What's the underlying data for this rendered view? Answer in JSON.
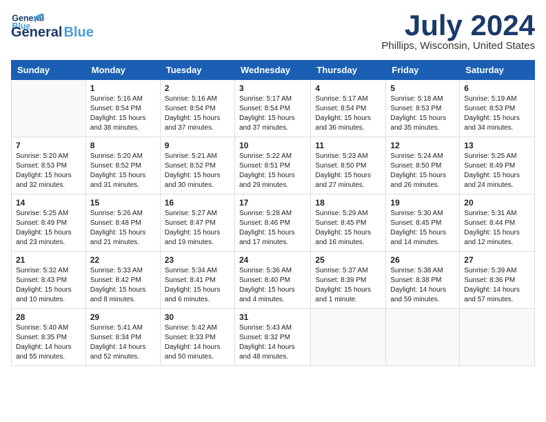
{
  "header": {
    "logo_line1": "General",
    "logo_line2": "Blue",
    "month": "July 2024",
    "location": "Phillips, Wisconsin, United States"
  },
  "weekdays": [
    "Sunday",
    "Monday",
    "Tuesday",
    "Wednesday",
    "Thursday",
    "Friday",
    "Saturday"
  ],
  "weeks": [
    [
      {
        "day": "",
        "info": ""
      },
      {
        "day": "1",
        "info": "Sunrise: 5:16 AM\nSunset: 8:54 PM\nDaylight: 15 hours\nand 38 minutes."
      },
      {
        "day": "2",
        "info": "Sunrise: 5:16 AM\nSunset: 8:54 PM\nDaylight: 15 hours\nand 37 minutes."
      },
      {
        "day": "3",
        "info": "Sunrise: 5:17 AM\nSunset: 8:54 PM\nDaylight: 15 hours\nand 37 minutes."
      },
      {
        "day": "4",
        "info": "Sunrise: 5:17 AM\nSunset: 8:54 PM\nDaylight: 15 hours\nand 36 minutes."
      },
      {
        "day": "5",
        "info": "Sunrise: 5:18 AM\nSunset: 8:53 PM\nDaylight: 15 hours\nand 35 minutes."
      },
      {
        "day": "6",
        "info": "Sunrise: 5:19 AM\nSunset: 8:53 PM\nDaylight: 15 hours\nand 34 minutes."
      }
    ],
    [
      {
        "day": "7",
        "info": "Sunrise: 5:20 AM\nSunset: 8:53 PM\nDaylight: 15 hours\nand 32 minutes."
      },
      {
        "day": "8",
        "info": "Sunrise: 5:20 AM\nSunset: 8:52 PM\nDaylight: 15 hours\nand 31 minutes."
      },
      {
        "day": "9",
        "info": "Sunrise: 5:21 AM\nSunset: 8:52 PM\nDaylight: 15 hours\nand 30 minutes."
      },
      {
        "day": "10",
        "info": "Sunrise: 5:22 AM\nSunset: 8:51 PM\nDaylight: 15 hours\nand 29 minutes."
      },
      {
        "day": "11",
        "info": "Sunrise: 5:23 AM\nSunset: 8:50 PM\nDaylight: 15 hours\nand 27 minutes."
      },
      {
        "day": "12",
        "info": "Sunrise: 5:24 AM\nSunset: 8:50 PM\nDaylight: 15 hours\nand 26 minutes."
      },
      {
        "day": "13",
        "info": "Sunrise: 5:25 AM\nSunset: 8:49 PM\nDaylight: 15 hours\nand 24 minutes."
      }
    ],
    [
      {
        "day": "14",
        "info": "Sunrise: 5:25 AM\nSunset: 8:49 PM\nDaylight: 15 hours\nand 23 minutes."
      },
      {
        "day": "15",
        "info": "Sunrise: 5:26 AM\nSunset: 8:48 PM\nDaylight: 15 hours\nand 21 minutes."
      },
      {
        "day": "16",
        "info": "Sunrise: 5:27 AM\nSunset: 8:47 PM\nDaylight: 15 hours\nand 19 minutes."
      },
      {
        "day": "17",
        "info": "Sunrise: 5:28 AM\nSunset: 8:46 PM\nDaylight: 15 hours\nand 17 minutes."
      },
      {
        "day": "18",
        "info": "Sunrise: 5:29 AM\nSunset: 8:45 PM\nDaylight: 15 hours\nand 16 minutes."
      },
      {
        "day": "19",
        "info": "Sunrise: 5:30 AM\nSunset: 8:45 PM\nDaylight: 15 hours\nand 14 minutes."
      },
      {
        "day": "20",
        "info": "Sunrise: 5:31 AM\nSunset: 8:44 PM\nDaylight: 15 hours\nand 12 minutes."
      }
    ],
    [
      {
        "day": "21",
        "info": "Sunrise: 5:32 AM\nSunset: 8:43 PM\nDaylight: 15 hours\nand 10 minutes."
      },
      {
        "day": "22",
        "info": "Sunrise: 5:33 AM\nSunset: 8:42 PM\nDaylight: 15 hours\nand 8 minutes."
      },
      {
        "day": "23",
        "info": "Sunrise: 5:34 AM\nSunset: 8:41 PM\nDaylight: 15 hours\nand 6 minutes."
      },
      {
        "day": "24",
        "info": "Sunrise: 5:36 AM\nSunset: 8:40 PM\nDaylight: 15 hours\nand 4 minutes."
      },
      {
        "day": "25",
        "info": "Sunrise: 5:37 AM\nSunset: 8:39 PM\nDaylight: 15 hours\nand 1 minute."
      },
      {
        "day": "26",
        "info": "Sunrise: 5:38 AM\nSunset: 8:38 PM\nDaylight: 14 hours\nand 59 minutes."
      },
      {
        "day": "27",
        "info": "Sunrise: 5:39 AM\nSunset: 8:36 PM\nDaylight: 14 hours\nand 57 minutes."
      }
    ],
    [
      {
        "day": "28",
        "info": "Sunrise: 5:40 AM\nSunset: 8:35 PM\nDaylight: 14 hours\nand 55 minutes."
      },
      {
        "day": "29",
        "info": "Sunrise: 5:41 AM\nSunset: 8:34 PM\nDaylight: 14 hours\nand 52 minutes."
      },
      {
        "day": "30",
        "info": "Sunrise: 5:42 AM\nSunset: 8:33 PM\nDaylight: 14 hours\nand 50 minutes."
      },
      {
        "day": "31",
        "info": "Sunrise: 5:43 AM\nSunset: 8:32 PM\nDaylight: 14 hours\nand 48 minutes."
      },
      {
        "day": "",
        "info": ""
      },
      {
        "day": "",
        "info": ""
      },
      {
        "day": "",
        "info": ""
      }
    ]
  ]
}
